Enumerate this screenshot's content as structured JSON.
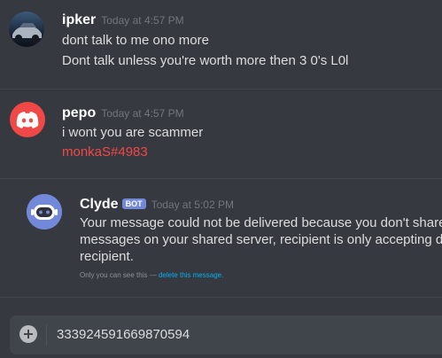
{
  "messages": [
    {
      "author": "ipker",
      "timestamp": "Today at 4:57 PM",
      "lines": [
        "dont talk to me ono more",
        "Dont talk unless you're worth more then 3 0's L0l"
      ]
    },
    {
      "author": "pepo",
      "timestamp": "Today at 4:57 PM",
      "lines": [
        "i wont you are scammer"
      ],
      "mention": "monkaS#4983"
    }
  ],
  "bot_message": {
    "author": "Clyde",
    "tag": "BOT",
    "timestamp": "Today at 5:02 PM",
    "lines": [
      "Your message could not be delivered because you don't share a se",
      "messages on your shared server, recipient is only accepting direct",
      "recipient."
    ],
    "ephemeral_notice": "Only you can see this —",
    "delete_link": "delete this message."
  },
  "composer": {
    "value": "333924591669870594"
  },
  "colors": {
    "background": "#36393f",
    "discord_red": "#f04747",
    "blurple": "#7289da",
    "link": "#00b0f4"
  }
}
